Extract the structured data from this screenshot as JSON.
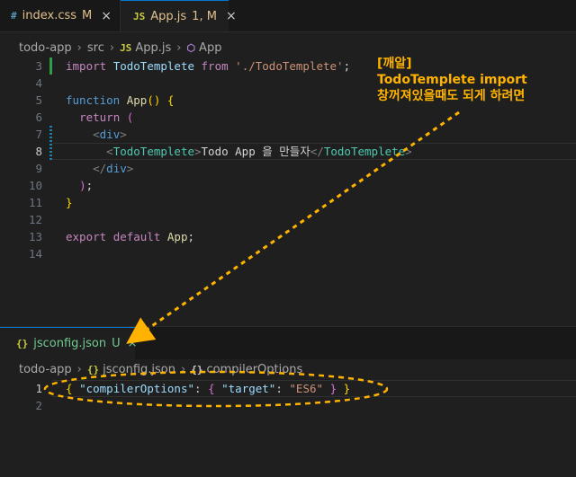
{
  "tabs": [
    {
      "icon": "#",
      "name": "index.css",
      "status": "M"
    },
    {
      "icon": "JS",
      "name": "App.js",
      "status": "1, M"
    }
  ],
  "close_symbol": "×",
  "breadcrumb_top": {
    "items": [
      "todo-app",
      "src",
      "App.js",
      "App"
    ],
    "icons": [
      "JS",
      "⬡"
    ]
  },
  "editor_top": {
    "lines": [
      {
        "n": "3",
        "tokens": [
          [
            "import",
            "k"
          ],
          [
            " ",
            "w"
          ],
          [
            "TodoTemplete",
            "v"
          ],
          [
            " ",
            "w"
          ],
          [
            "from",
            "k"
          ],
          [
            " ",
            "w"
          ],
          [
            "'./TodoTemplete'",
            "s"
          ],
          [
            ";",
            "w"
          ]
        ]
      },
      {
        "n": "4",
        "tokens": []
      },
      {
        "n": "5",
        "tokens": [
          [
            "function",
            "tag"
          ],
          [
            " ",
            "w"
          ],
          [
            "App",
            "f"
          ],
          [
            "()",
            "b"
          ],
          [
            " ",
            "w"
          ],
          [
            "{",
            "b"
          ]
        ]
      },
      {
        "n": "6",
        "tokens": [
          [
            "  ",
            "w"
          ],
          [
            "return",
            "k"
          ],
          [
            " ",
            "w"
          ],
          [
            "(",
            "bp"
          ]
        ]
      },
      {
        "n": "7",
        "tokens": [
          [
            "    ",
            "w"
          ],
          [
            "<",
            "p"
          ],
          [
            "div",
            "tag"
          ],
          [
            ">",
            "p"
          ]
        ]
      },
      {
        "n": "8",
        "tokens": [
          [
            "      ",
            "w"
          ],
          [
            "<",
            "p"
          ],
          [
            "TodoTemplete",
            "t"
          ],
          [
            ">",
            "p"
          ],
          [
            "Todo App 을 만들자",
            "w"
          ],
          [
            "</",
            "p"
          ],
          [
            "TodoTemplete",
            "t"
          ],
          [
            ">",
            "p"
          ]
        ]
      },
      {
        "n": "9",
        "tokens": [
          [
            "    ",
            "w"
          ],
          [
            "</",
            "p"
          ],
          [
            "div",
            "tag"
          ],
          [
            ">",
            "p"
          ]
        ]
      },
      {
        "n": "10",
        "tokens": [
          [
            "  ",
            "w"
          ],
          [
            ")",
            "bp"
          ],
          [
            ";",
            "w"
          ]
        ]
      },
      {
        "n": "11",
        "tokens": [
          [
            "}",
            "b"
          ]
        ]
      },
      {
        "n": "12",
        "tokens": []
      },
      {
        "n": "13",
        "tokens": [
          [
            "export",
            "k"
          ],
          [
            " ",
            "w"
          ],
          [
            "default",
            "k"
          ],
          [
            " ",
            "w"
          ],
          [
            "App",
            "f"
          ],
          [
            ";",
            "w"
          ]
        ]
      },
      {
        "n": "14",
        "tokens": []
      }
    ],
    "active_line": "8"
  },
  "annotation": [
    "[깨알]",
    "TodoTemplete import",
    "창꺼져있을때도 되게 하려면"
  ],
  "bottom_tab": {
    "icon": "{}",
    "name": "jsconfig.json",
    "status": "U"
  },
  "breadcrumb_bottom": {
    "items": [
      "todo-app",
      "jsconfig.json",
      "compilerOptions"
    ],
    "icons": [
      "{}",
      "{}"
    ]
  },
  "editor_bottom": {
    "lines": [
      {
        "n": "1",
        "tokens": [
          [
            "{",
            "b"
          ],
          [
            " ",
            "w"
          ],
          [
            "\"compilerOptions\"",
            "v"
          ],
          [
            ": ",
            "w"
          ],
          [
            "{",
            "bp"
          ],
          [
            " ",
            "w"
          ],
          [
            "\"target\"",
            "v"
          ],
          [
            ": ",
            "w"
          ],
          [
            "\"ES6\"",
            "s"
          ],
          [
            " ",
            "w"
          ],
          [
            "}",
            "bp"
          ],
          [
            " ",
            "w"
          ],
          [
            "}",
            "b"
          ]
        ]
      },
      {
        "n": "2",
        "tokens": []
      }
    ]
  },
  "colors": {
    "annotation": "#ffb300",
    "accent": "#0078d4"
  }
}
